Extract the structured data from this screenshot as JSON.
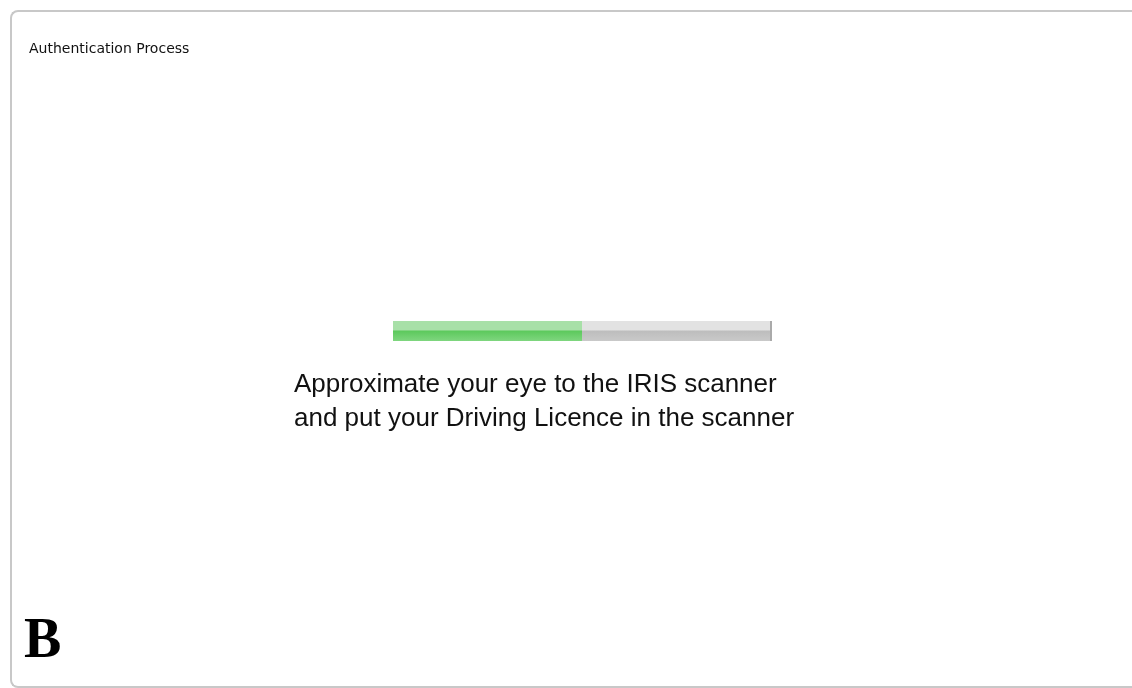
{
  "window": {
    "title": "Authentication Process"
  },
  "progress": {
    "level": 0.5
  },
  "instructions": [
    "Approximate your eye to the IRIS scanner",
    "and put your Driving Licence in the scanner"
  ],
  "logo": "B"
}
